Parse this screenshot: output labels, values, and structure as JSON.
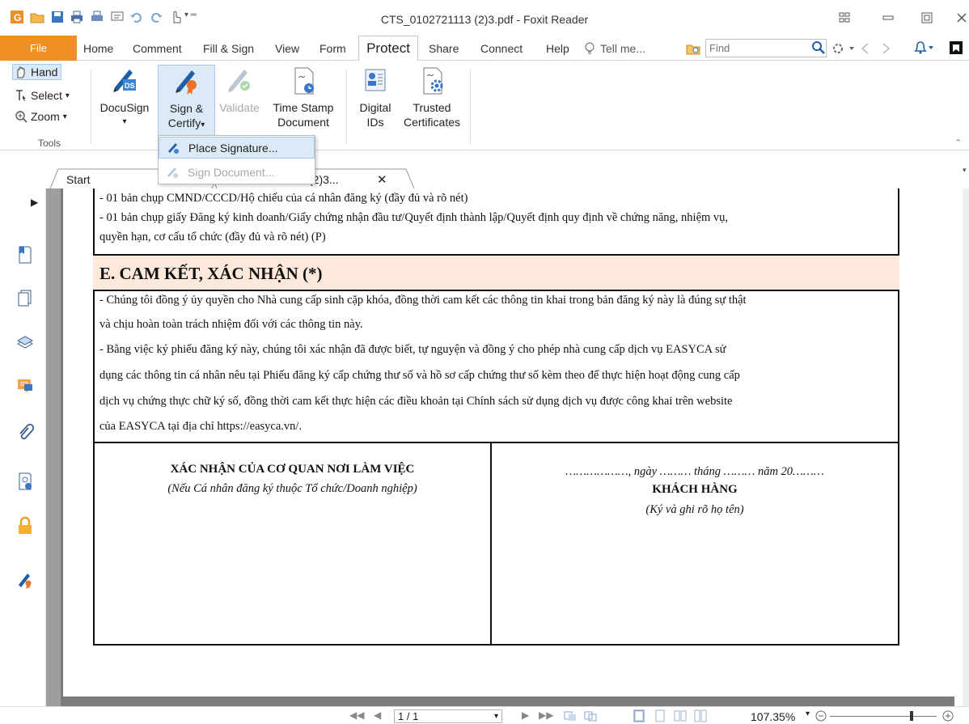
{
  "window": {
    "title": "CTS_0102721113 (2)3.pdf - Foxit Reader"
  },
  "menu": {
    "file": "File",
    "items": [
      "Home",
      "Comment",
      "Fill & Sign",
      "View",
      "Form",
      "Protect",
      "Share",
      "Connect",
      "Help"
    ],
    "tell_me": "Tell me...",
    "find_placeholder": "Find"
  },
  "ribbon": {
    "tools": {
      "hand": "Hand",
      "select": "Select",
      "zoom": "Zoom",
      "group_label": "Tools"
    },
    "buttons": {
      "docusign": "DocuSign",
      "sign_certify_line1": "Sign &",
      "sign_certify_line2": "Certify",
      "validate": "Validate",
      "timestamp_line1": "Time Stamp",
      "timestamp_line2": "Document",
      "digital_ids_line1": "Digital",
      "digital_ids_line2": "IDs",
      "trusted_line1": "Trusted",
      "trusted_line2": "Certificates"
    }
  },
  "dropdown": {
    "place_signature": "Place Signature...",
    "sign_document": "Sign Document..."
  },
  "tabs": {
    "start": "Start",
    "document": "(2)3..."
  },
  "document": {
    "line1": "-  01 bản chụp CMND/CCCD/Hộ chiếu của cá nhân đăng ký (đầy đủ và rõ nét)",
    "line2": "-  01 bản chụp giấy Đăng ký kinh doanh/Giấy chứng nhận đầu tư/Quyết định thành lập/Quyết định quy định về chứng năng, nhiệm vụ,",
    "line3": "quyền hạn, cơ cấu tổ chức (đầy đủ và rõ nét) (P)",
    "section_title": "E. CAM KẾT, XÁC NHẬN (*)",
    "para1_line1": "- Chúng tôi đồng ý ủy quyền cho Nhà cung cấp sinh cặp khóa, đồng thời cam kết các thông tin khai trong bản đăng ký này là đúng sự thật",
    "para1_line2": "và chịu hoàn toàn trách nhiệm đối với các thông tin này.",
    "para2_line1": "- Bằng việc ký phiếu đăng ký này, chúng tôi xác nhận đã được biết, tự nguyện và đồng ý cho phép nhà cung cấp dịch vụ EASYCA sử",
    "para2_line2": "dụng các thông tin cá nhân nêu tại Phiếu đăng ký cấp chứng thư số và hồ sơ cấp chứng thư số kèm theo để thực hiện hoạt động cung cấp",
    "para2_line3": "dịch vụ chứng thực chữ ký số, đồng thời cam kết thực hiện các điều khoản tại Chính sách sử dụng dịch vụ được công khai trên website",
    "para2_line4": "của EASYCA tại địa chỉ https://easyca.vn/.",
    "left_sig_title": "XÁC NHẬN CỦA CƠ QUAN NƠI LÀM VIỆC",
    "left_sig_note": "(Nếu Cá nhân đăng ký thuộc Tổ chức/Doanh nghiệp)",
    "right_sig_date": "………………, ngày ……… tháng ……… năm 20………",
    "right_sig_title": "KHÁCH HÀNG",
    "right_sig_note": "(Ký và ghi rõ họ tên)"
  },
  "status": {
    "page": "1 / 1",
    "zoom": "107.35%"
  },
  "colors": {
    "file_tab": "#f28f22",
    "section_header_bg": "#fde9db",
    "highlight": "#dce9f6"
  }
}
